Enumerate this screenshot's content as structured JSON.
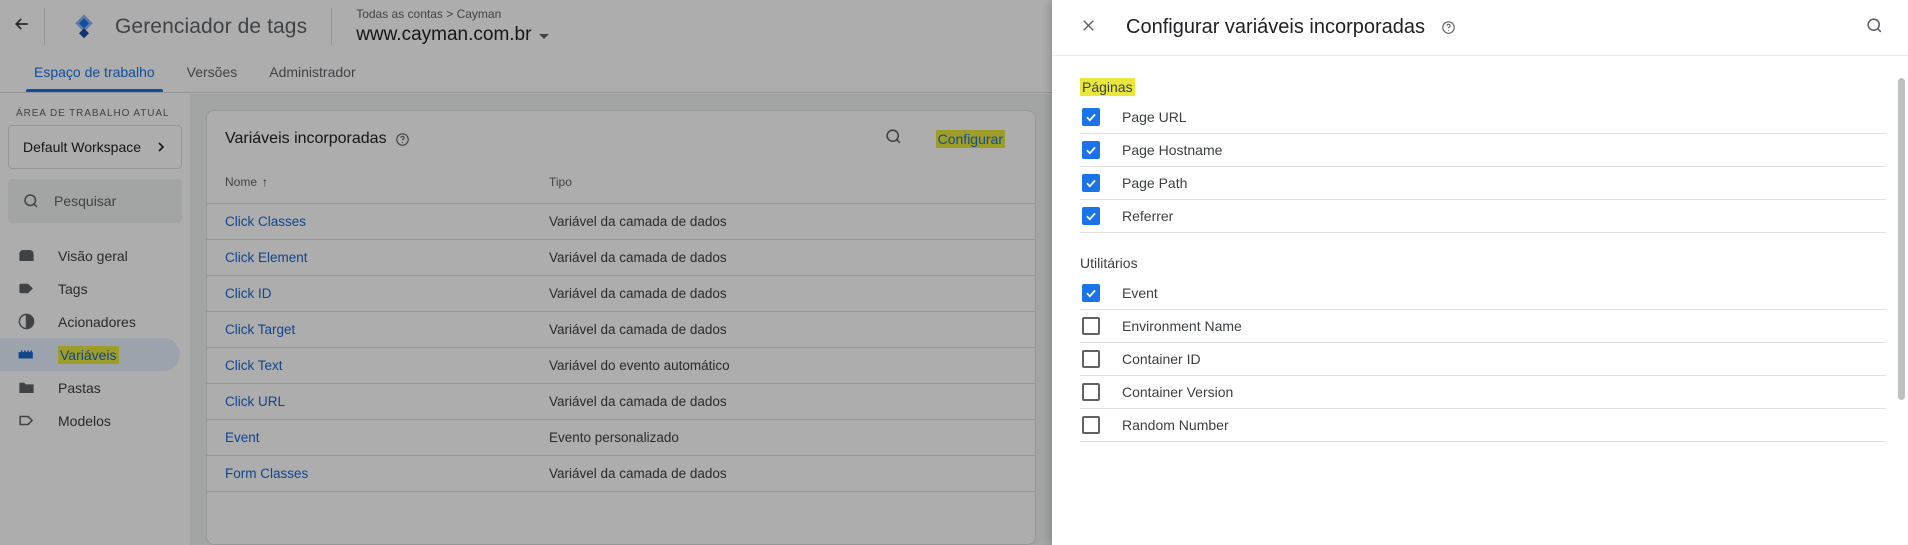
{
  "app": {
    "back_icon": "arrow-left-icon",
    "logo_icon": "tag-manager-logo",
    "title": "Gerenciador de tags",
    "breadcrumb": "Todas as contas > Cayman",
    "container_name": "www.cayman.com.br",
    "container_caret_icon": "caret-down-icon"
  },
  "tabs": [
    {
      "label": "Espaço de trabalho",
      "active": true
    },
    {
      "label": "Versões",
      "active": false
    },
    {
      "label": "Administrador",
      "active": false
    }
  ],
  "sidebar": {
    "section_label": "ÁREA DE TRABALHO ATUAL",
    "workspace": {
      "name": "Default Workspace",
      "chevron_icon": "chevron-right-icon"
    },
    "search": {
      "icon": "search-icon",
      "placeholder": "Pesquisar"
    },
    "items": [
      {
        "label": "Visão geral",
        "icon": "overview-icon",
        "selected": false,
        "highlighted": false
      },
      {
        "label": "Tags",
        "icon": "tag-icon",
        "selected": false,
        "highlighted": false
      },
      {
        "label": "Acionadores",
        "icon": "trigger-icon",
        "selected": false,
        "highlighted": false
      },
      {
        "label": "Variáveis",
        "icon": "variable-icon",
        "selected": true,
        "highlighted": true
      },
      {
        "label": "Pastas",
        "icon": "folder-icon",
        "selected": false,
        "highlighted": false
      },
      {
        "label": "Modelos",
        "icon": "template-icon",
        "selected": false,
        "highlighted": false
      }
    ]
  },
  "main": {
    "card_title": "Variáveis incorporadas",
    "card_help_icon": "help-icon",
    "search_icon": "search-icon",
    "configure_button": "Configurar",
    "columns": [
      "Nome",
      "Tipo"
    ],
    "sort_arrow": "↑",
    "rows": [
      {
        "name": "Click Classes",
        "type": "Variável da camada de dados"
      },
      {
        "name": "Click Element",
        "type": "Variável da camada de dados"
      },
      {
        "name": "Click ID",
        "type": "Variável da camada de dados"
      },
      {
        "name": "Click Target",
        "type": "Variável da camada de dados"
      },
      {
        "name": "Click Text",
        "type": "Variável do evento automático"
      },
      {
        "name": "Click URL",
        "type": "Variável da camada de dados"
      },
      {
        "name": "Event",
        "type": "Evento personalizado"
      },
      {
        "name": "Form Classes",
        "type": "Variável da camada de dados"
      }
    ]
  },
  "panel": {
    "close_icon": "close-icon",
    "title": "Configurar variáveis incorporadas",
    "help_icon": "help-icon",
    "search_icon": "search-icon",
    "groups": [
      {
        "label": "Páginas",
        "highlighted": true,
        "options": [
          {
            "label": "Page URL",
            "checked": true
          },
          {
            "label": "Page Hostname",
            "checked": true
          },
          {
            "label": "Page Path",
            "checked": true
          },
          {
            "label": "Referrer",
            "checked": true
          }
        ]
      },
      {
        "label": "Utilitários",
        "highlighted": false,
        "options": [
          {
            "label": "Event",
            "checked": true
          },
          {
            "label": "Environment Name",
            "checked": false
          },
          {
            "label": "Container ID",
            "checked": false
          },
          {
            "label": "Container Version",
            "checked": false
          },
          {
            "label": "Random Number",
            "checked": false
          }
        ]
      }
    ]
  },
  "colors": {
    "accent_blue": "#1a73e8",
    "link_blue": "#1967d2",
    "selected_nav_bg": "#e8f0fe",
    "highlight_yellow": "#e9e83a",
    "text_primary": "#202124",
    "text_secondary": "#5f6368"
  }
}
